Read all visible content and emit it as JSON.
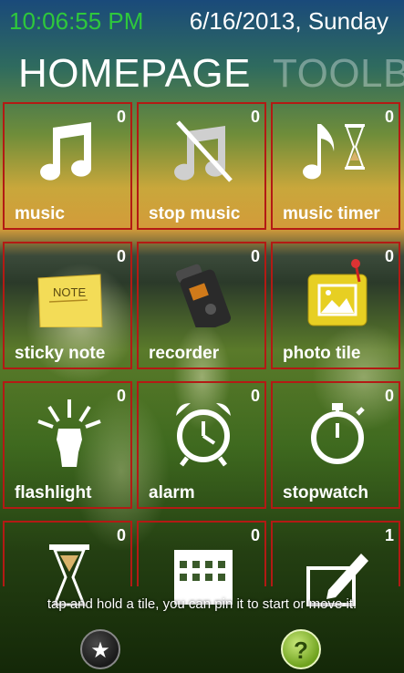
{
  "status": {
    "time": "10:06:55 PM",
    "date": "6/16/2013, Sunday"
  },
  "pivot": {
    "current": "HOMEPAGE",
    "next": "TOOLBO"
  },
  "tiles": [
    {
      "label": "music",
      "count": "0",
      "icon": "music-note-icon"
    },
    {
      "label": "stop music",
      "count": "0",
      "icon": "stop-music-icon"
    },
    {
      "label": "music timer",
      "count": "0",
      "icon": "music-timer-icon"
    },
    {
      "label": "sticky note",
      "count": "0",
      "icon": "sticky-note-icon"
    },
    {
      "label": "recorder",
      "count": "0",
      "icon": "recorder-icon"
    },
    {
      "label": "photo tile",
      "count": "0",
      "icon": "photo-tile-icon"
    },
    {
      "label": "flashlight",
      "count": "0",
      "icon": "flashlight-icon"
    },
    {
      "label": "alarm",
      "count": "0",
      "icon": "alarm-clock-icon"
    },
    {
      "label": "stopwatch",
      "count": "0",
      "icon": "stopwatch-icon"
    },
    {
      "label": "",
      "count": "0",
      "icon": "hourglass-icon"
    },
    {
      "label": "",
      "count": "0",
      "icon": "calendar-icon"
    },
    {
      "label": "",
      "count": "1",
      "icon": "edit-pen-icon"
    }
  ],
  "hint": "tap and hold a tile, you can pin it to start or move it.",
  "buttons": {
    "favorite_glyph": "★",
    "help_glyph": "?"
  },
  "colors": {
    "tile_border": "#b31a14",
    "time": "#2ec83c"
  }
}
